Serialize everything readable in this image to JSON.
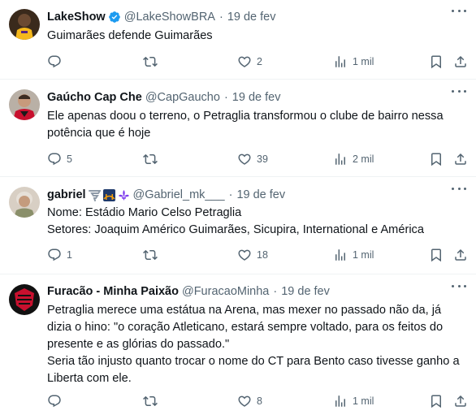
{
  "tweets": [
    {
      "name": "LakeShow",
      "handle": "@LakeShowBRA",
      "separator": "·",
      "date": "19 de fev",
      "verified": true,
      "text": [
        "Guimarães defende Guimarães"
      ],
      "replies": "",
      "retweets": "",
      "likes": "2",
      "views": "1 mil"
    },
    {
      "name": "Gaúcho Cap Che",
      "handle": "@CapGaucho",
      "separator": "·",
      "date": "19 de fev",
      "text": [
        "Ele apenas doou o terreno, o Petraglia transformou o clube de bairro nessa",
        "potência que é hoje"
      ],
      "replies": "5",
      "retweets": "",
      "likes": "39",
      "views": "2 mil"
    },
    {
      "name": "gabriel",
      "handle": "@Gabriel_mk___",
      "separator": "·",
      "date": "19 de fev",
      "emoji_icons": [
        "tornado-emoji-icon",
        "bridge-at-night-emoji-icon",
        "fleur-de-lis-emoji-icon"
      ],
      "text": [
        "Nome: Estádio Mario Celso Petraglia",
        "Setores: Joaquim Américo Guimarães, Sicupira, International e América"
      ],
      "replies": "1",
      "retweets": "",
      "likes": "18",
      "views": "1 mil"
    },
    {
      "name": "Furacão - Minha Paixão",
      "handle": "@FuracaoMinha",
      "separator": "·",
      "date": "19 de fev",
      "text": [
        "Petraglia merece uma estátua na Arena, mas mexer no passado não da, já",
        "dizia o hino: \"o coração Atleticano, estará sempre voltado, para os feitos do",
        "presente e as glórias do passado.\"",
        "Seria tão injusto quanto trocar o nome do CT para Bento caso tivesse ganho a",
        "Liberta com ele."
      ],
      "replies": "",
      "retweets": "",
      "likes": "8",
      "views": "1 mil"
    }
  ],
  "colors": {
    "verified": "#1d9bf0",
    "secondary_text": "#536471",
    "primary_text": "#0f1419",
    "divider": "#eff3f4"
  },
  "icons": [
    "more-icon",
    "reply-icon",
    "retweet-icon",
    "like-icon",
    "views-icon",
    "bookmark-icon",
    "share-icon"
  ]
}
